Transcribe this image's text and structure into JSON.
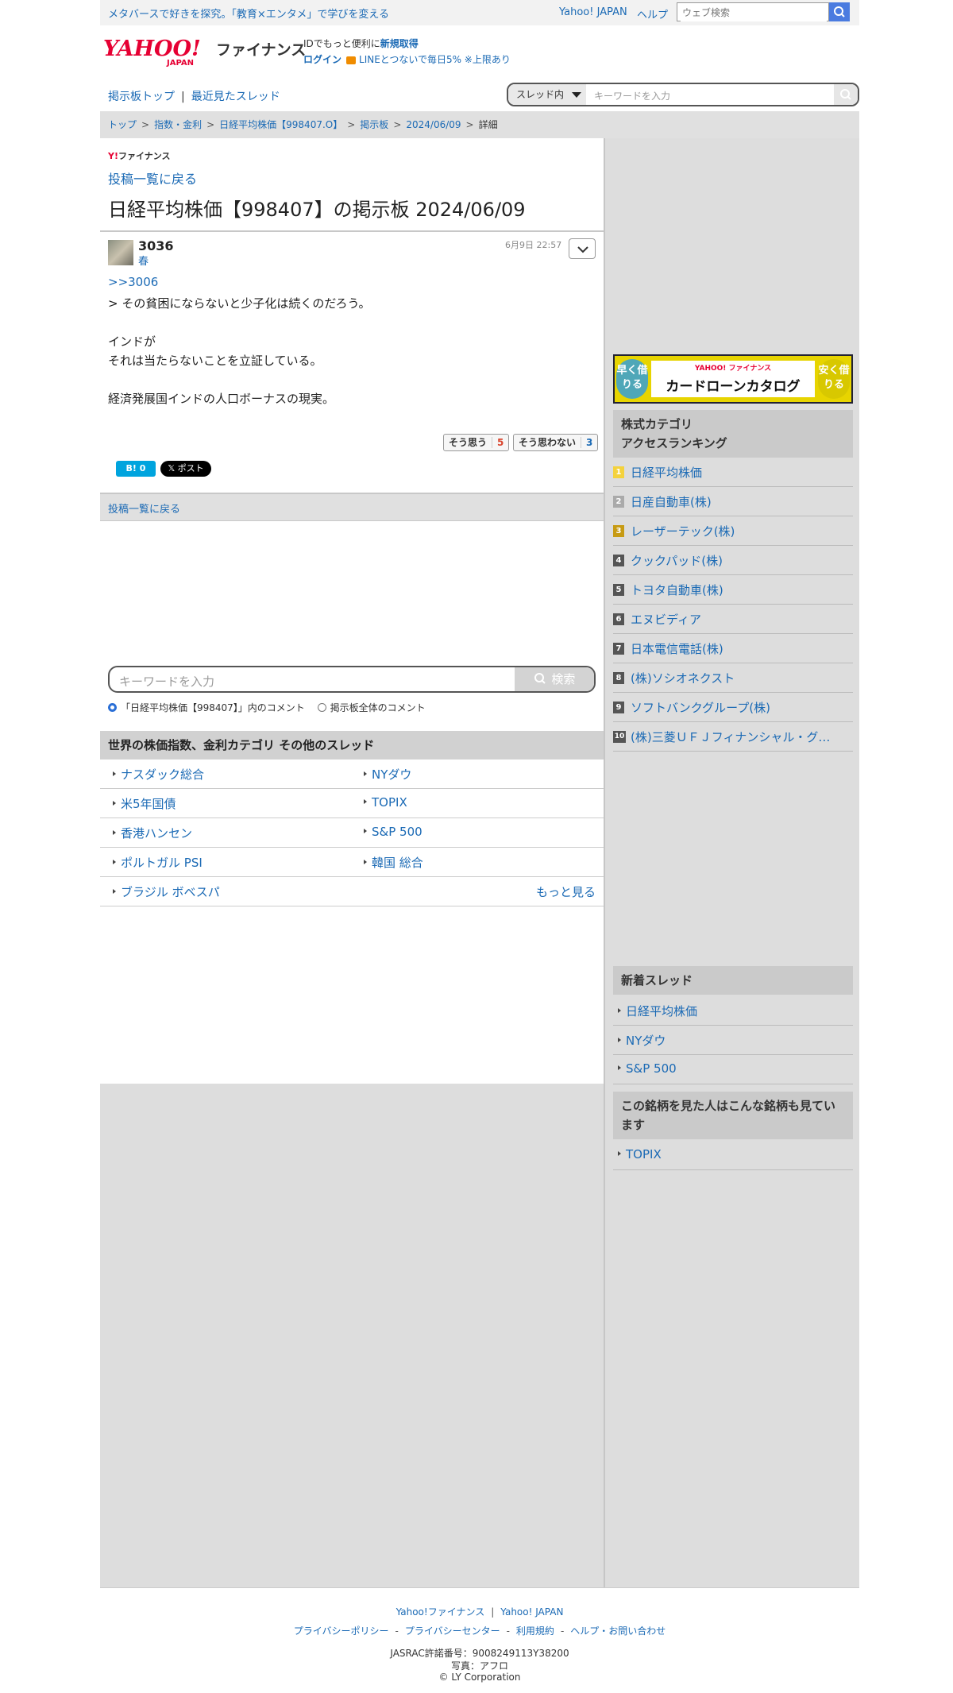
{
  "topbar": {
    "promo": "メタバースで好きを探究。「教育×エンタメ」で学びを変える",
    "yahoo_japan": "Yahoo! JAPAN",
    "help": "ヘルプ",
    "web_search_placeholder": "ウェブ検索"
  },
  "header": {
    "logo_line1": "YAHOO!",
    "logo_line2": "JAPAN",
    "brand": "ファイナンス",
    "id_text": "IDでもっと便利に",
    "register": "新規取得",
    "login": "ログイン",
    "line_promo": "LINEとつないで毎日5% ※上限あり"
  },
  "nav": {
    "board_top": "掲示板トップ",
    "sep": "|",
    "recent": "最近見たスレッド",
    "scope": "スレッド内",
    "keyword_placeholder": "キーワードを入力"
  },
  "breadcrumb": [
    "トップ",
    "指数・金利",
    "日経平均株価【998407.O】",
    "掲示板",
    "2024/06/09",
    "詳細"
  ],
  "breadcrumb_sep": ">",
  "post": {
    "yf_y": "Y!",
    "yf_text": "ファイナンス",
    "back_label": "投稿一覧に戻る",
    "title": "日経平均株価【998407】の掲示板 2024/06/09",
    "comment_no": "3036",
    "author": "春",
    "date": "6月9日 22:57",
    "reply_to": ">>3006",
    "body_lines": [
      "> その貧困にならないと少子化は続くのだろう。",
      "",
      "インドが",
      "それは当たらないことを立証している。",
      "",
      "経済発展国インドの人口ボーナスの現実。"
    ],
    "agree_label": "そう思う",
    "agree_count": "5",
    "disagree_label": "そう思わない",
    "disagree_count": "3",
    "hatena_label": "B! 0",
    "x_label": "𝕏 ポスト"
  },
  "backbar": {
    "label": "投稿一覧に戻る"
  },
  "search": {
    "placeholder": "キーワードを入力",
    "button": "検索",
    "radio1": "「日経平均株価【998407】」内のコメント",
    "radio2": "掲示板全体のコメント"
  },
  "other_threads": {
    "heading": "世界の株価指数、金利カテゴリ  その他のスレッド",
    "rows": [
      [
        "ナスダック総合",
        "NYダウ"
      ],
      [
        "米5年国債",
        "TOPIX"
      ],
      [
        "香港ハンセン",
        "S&P 500"
      ],
      [
        "ポルトガル PSI",
        "韓国 総合"
      ],
      [
        "ブラジル ボベスパ",
        ""
      ]
    ],
    "more": "もっと見る"
  },
  "sidebar": {
    "ad": {
      "left": "早く借りる",
      "right": "安く借りる",
      "brand": "YAHOO! ファイナンス",
      "catalog": "カードローンカタログ"
    },
    "ranking_heading_1": "株式カテゴリ",
    "ranking_heading_2": "アクセスランキング",
    "ranking": [
      {
        "rank": "1",
        "name": "日経平均株価"
      },
      {
        "rank": "2",
        "name": "日産自動車(株)"
      },
      {
        "rank": "3",
        "name": "レーザーテック(株)"
      },
      {
        "rank": "4",
        "name": "クックパッド(株)"
      },
      {
        "rank": "5",
        "name": "トヨタ自動車(株)"
      },
      {
        "rank": "6",
        "name": "エヌビディア"
      },
      {
        "rank": "7",
        "name": "日本電信電話(株)"
      },
      {
        "rank": "8",
        "name": "(株)ソシオネクスト"
      },
      {
        "rank": "9",
        "name": "ソフトバンクグループ(株)"
      },
      {
        "rank": "10",
        "name": "(株)三菱ＵＦＪフィナンシャル・グ…"
      }
    ],
    "new_threads_heading": "新着スレッド",
    "new_threads": [
      "日経平均株価",
      "NYダウ",
      "S&P 500"
    ],
    "also_viewed_heading": "この銘柄を見た人はこんな銘柄も見ています",
    "also_viewed": [
      "TOPIX"
    ]
  },
  "footer": {
    "link1": "Yahoo!ファイナンス",
    "link2": "Yahoo! JAPAN",
    "privacy_policy": "プライバシーポリシー",
    "privacy_center": "プライバシーセンター",
    "terms": "利用規約",
    "help_contact": "ヘルプ・お問い合わせ",
    "pipe": "|",
    "dash": "-",
    "jasrac": "JASRAC許諾番号：9008249113Y38200",
    "photo": "写真：アフロ",
    "copyright": "© LY Corporation"
  },
  "colors": {
    "link": "#1b6ab5",
    "yahoo_red": "#e60033",
    "search_blue": "#4a7be0",
    "agree": "#d9452e",
    "disagree": "#1b6ab5"
  }
}
